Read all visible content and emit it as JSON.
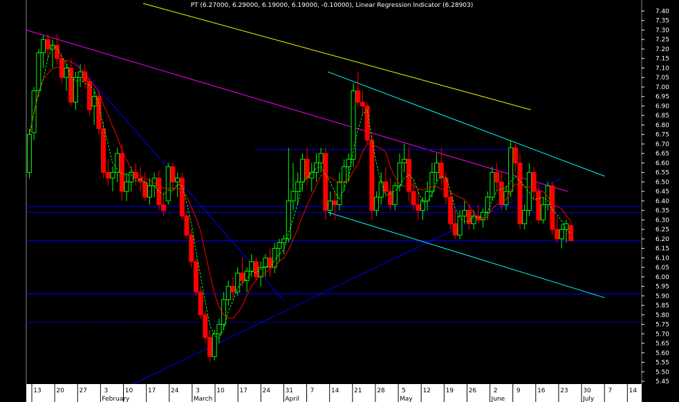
{
  "chart_data": {
    "type": "candlestick",
    "title": "PT (6.27000, 6.29000, 6.19000, 6.19000, -0.10000), Linear Regression Indicator (6.28903)",
    "ylim": [
      5.4,
      7.4
    ],
    "y_ticks": [
      "7.40",
      "7.35",
      "7.30",
      "7.25",
      "7.20",
      "7.15",
      "7.10",
      "7.05",
      "7.00",
      "6.95",
      "6.90",
      "6.85",
      "6.80",
      "6.75",
      "6.70",
      "6.65",
      "6.60",
      "6.55",
      "6.50",
      "6.45",
      "6.40",
      "6.35",
      "6.30",
      "6.25",
      "6.20",
      "6.15",
      "6.10",
      "6.05",
      "6.00",
      "5.95",
      "5.90",
      "5.85",
      "5.80",
      "5.75",
      "5.70",
      "5.65",
      "5.60",
      "5.55",
      "5.50",
      "5.45"
    ],
    "x_ticks": [
      "13",
      "20",
      "27",
      "3",
      "10",
      "17",
      "24",
      "3",
      "10",
      "17",
      "24",
      "31",
      "7",
      "14",
      "21",
      "28",
      "5",
      "12",
      "19",
      "26",
      "2",
      "9",
      "16",
      "23",
      "30",
      "7",
      "14"
    ],
    "months": [
      "February",
      "March",
      "April",
      "May",
      "June",
      "July"
    ],
    "colors": {
      "up": "#00ff00",
      "down": "#ff0000",
      "background": "#000000",
      "axis_bg": "#ffffff"
    },
    "horizontal_levels": [
      6.37,
      6.34,
      6.19,
      5.91,
      5.76
    ],
    "candles": [
      [
        6.55,
        6.78,
        6.52,
        6.75
      ],
      [
        6.76,
        7.0,
        6.72,
        6.98
      ],
      [
        6.98,
        7.2,
        6.95,
        7.18
      ],
      [
        7.18,
        7.27,
        7.1,
        7.25
      ],
      [
        7.25,
        7.28,
        7.15,
        7.2
      ],
      [
        7.2,
        7.25,
        7.1,
        7.22
      ],
      [
        7.22,
        7.28,
        7.12,
        7.15
      ],
      [
        7.15,
        7.18,
        7.02,
        7.05
      ],
      [
        7.05,
        7.12,
        6.98,
        7.1
      ],
      [
        7.1,
        7.15,
        6.9,
        6.92
      ],
      [
        6.92,
        7.08,
        6.88,
        7.05
      ],
      [
        7.05,
        7.12,
        7.0,
        7.08
      ],
      [
        7.08,
        7.12,
        7.0,
        7.03
      ],
      [
        7.03,
        7.05,
        6.85,
        6.88
      ],
      [
        6.9,
        6.98,
        6.8,
        6.95
      ],
      [
        6.95,
        6.98,
        6.75,
        6.78
      ],
      [
        6.78,
        6.82,
        6.52,
        6.55
      ],
      [
        6.55,
        6.62,
        6.48,
        6.52
      ],
      [
        6.52,
        6.58,
        6.45,
        6.55
      ],
      [
        6.55,
        6.68,
        6.5,
        6.65
      ],
      [
        6.65,
        6.7,
        6.4,
        6.45
      ],
      [
        6.45,
        6.55,
        6.4,
        6.5
      ],
      [
        6.5,
        6.58,
        6.45,
        6.55
      ],
      [
        6.55,
        6.6,
        6.48,
        6.52
      ],
      [
        6.52,
        6.58,
        6.45,
        6.5
      ],
      [
        6.5,
        6.55,
        6.4,
        6.42
      ],
      [
        6.42,
        6.52,
        6.38,
        6.48
      ],
      [
        6.48,
        6.55,
        6.42,
        6.52
      ],
      [
        6.52,
        6.56,
        6.35,
        6.38
      ],
      [
        6.38,
        6.45,
        6.32,
        6.35
      ],
      [
        6.4,
        6.6,
        6.38,
        6.58
      ],
      [
        6.58,
        6.6,
        6.45,
        6.5
      ],
      [
        6.5,
        6.55,
        6.42,
        6.52
      ],
      [
        6.52,
        6.55,
        6.3,
        6.32
      ],
      [
        6.32,
        6.35,
        6.2,
        6.22
      ],
      [
        6.22,
        6.25,
        6.05,
        6.08
      ],
      [
        6.08,
        6.1,
        5.9,
        5.92
      ],
      [
        5.92,
        5.95,
        5.78,
        5.8
      ],
      [
        5.8,
        5.82,
        5.65,
        5.68
      ],
      [
        5.68,
        5.72,
        5.55,
        5.58
      ],
      [
        5.58,
        5.72,
        5.56,
        5.7
      ],
      [
        5.7,
        5.78,
        5.65,
        5.75
      ],
      [
        5.75,
        5.92,
        5.72,
        5.88
      ],
      [
        5.88,
        5.98,
        5.85,
        5.95
      ],
      [
        5.95,
        6.0,
        5.88,
        5.92
      ],
      [
        5.92,
        6.05,
        5.9,
        6.02
      ],
      [
        6.02,
        6.1,
        5.95,
        5.98
      ],
      [
        5.98,
        6.05,
        5.92,
        6.03
      ],
      [
        6.03,
        6.12,
        6.0,
        6.08
      ],
      [
        6.08,
        6.1,
        5.98,
        6.0
      ],
      [
        6.0,
        6.08,
        5.95,
        6.05
      ],
      [
        6.05,
        6.12,
        6.0,
        6.1
      ],
      [
        6.1,
        6.15,
        6.0,
        6.05
      ],
      [
        6.05,
        6.18,
        6.02,
        6.15
      ],
      [
        6.15,
        6.2,
        6.08,
        6.18
      ],
      [
        6.18,
        6.22,
        6.12,
        6.2
      ],
      [
        6.2,
        6.68,
        6.18,
        6.4
      ],
      [
        6.4,
        6.6,
        6.35,
        6.45
      ],
      [
        6.45,
        6.55,
        6.38,
        6.5
      ],
      [
        6.5,
        6.65,
        6.45,
        6.62
      ],
      [
        6.62,
        6.68,
        6.48,
        6.52
      ],
      [
        6.52,
        6.6,
        6.45,
        6.55
      ],
      [
        6.55,
        6.65,
        6.5,
        6.6
      ],
      [
        6.6,
        6.68,
        6.55,
        6.65
      ],
      [
        6.65,
        6.68,
        6.3,
        6.35
      ],
      [
        6.35,
        6.45,
        6.32,
        6.4
      ],
      [
        6.4,
        6.45,
        6.3,
        6.38
      ],
      [
        6.38,
        6.55,
        6.35,
        6.5
      ],
      [
        6.5,
        6.62,
        6.45,
        6.58
      ],
      [
        6.58,
        6.65,
        6.5,
        6.62
      ],
      [
        6.62,
        7.02,
        6.58,
        6.98
      ],
      [
        6.98,
        7.08,
        6.9,
        6.92
      ],
      [
        6.92,
        6.98,
        6.85,
        6.9
      ],
      [
        6.9,
        6.92,
        6.7,
        6.72
      ],
      [
        6.72,
        6.75,
        6.3,
        6.35
      ],
      [
        6.35,
        6.45,
        6.32,
        6.42
      ],
      [
        6.42,
        6.55,
        6.38,
        6.5
      ],
      [
        6.5,
        6.58,
        6.42,
        6.45
      ],
      [
        6.45,
        6.52,
        6.35,
        6.38
      ],
      [
        6.38,
        6.5,
        6.35,
        6.48
      ],
      [
        6.48,
        6.65,
        6.45,
        6.6
      ],
      [
        6.6,
        6.7,
        6.55,
        6.62
      ],
      [
        6.62,
        6.68,
        6.4,
        6.45
      ],
      [
        6.45,
        6.5,
        6.35,
        6.38
      ],
      [
        6.38,
        6.45,
        6.3,
        6.35
      ],
      [
        6.35,
        6.42,
        6.3,
        6.4
      ],
      [
        6.4,
        6.5,
        6.35,
        6.45
      ],
      [
        6.45,
        6.6,
        6.42,
        6.55
      ],
      [
        6.55,
        6.65,
        6.5,
        6.6
      ],
      [
        6.6,
        6.68,
        6.48,
        6.52
      ],
      [
        6.52,
        6.55,
        6.38,
        6.42
      ],
      [
        6.42,
        6.45,
        6.25,
        6.28
      ],
      [
        6.28,
        6.35,
        6.2,
        6.22
      ],
      [
        6.22,
        6.35,
        6.2,
        6.32
      ],
      [
        6.32,
        6.4,
        6.28,
        6.35
      ],
      [
        6.35,
        6.38,
        6.25,
        6.28
      ],
      [
        6.28,
        6.35,
        6.25,
        6.32
      ],
      [
        6.32,
        6.38,
        6.28,
        6.3
      ],
      [
        6.3,
        6.36,
        6.26,
        6.34
      ],
      [
        6.34,
        6.45,
        6.3,
        6.42
      ],
      [
        6.42,
        6.58,
        6.4,
        6.55
      ],
      [
        6.55,
        6.6,
        6.45,
        6.5
      ],
      [
        6.5,
        6.55,
        6.35,
        6.38
      ],
      [
        6.38,
        6.48,
        6.35,
        6.45
      ],
      [
        6.45,
        6.72,
        6.42,
        6.68
      ],
      [
        6.68,
        6.7,
        6.55,
        6.6
      ],
      [
        6.6,
        6.65,
        6.25,
        6.28
      ],
      [
        6.28,
        6.38,
        6.25,
        6.35
      ],
      [
        6.35,
        6.6,
        6.32,
        6.55
      ],
      [
        6.55,
        6.58,
        6.4,
        6.45
      ],
      [
        6.45,
        6.48,
        6.28,
        6.3
      ],
      [
        6.3,
        6.42,
        6.28,
        6.38
      ],
      [
        6.38,
        6.5,
        6.35,
        6.48
      ],
      [
        6.48,
        6.5,
        6.22,
        6.25
      ],
      [
        6.25,
        6.32,
        6.18,
        6.2
      ],
      [
        6.2,
        6.28,
        6.15,
        6.25
      ],
      [
        6.25,
        6.3,
        6.18,
        6.28
      ],
      [
        6.27,
        6.29,
        6.19,
        6.19
      ]
    ],
    "trend_lines": [
      {
        "color": "#ffff00",
        "from": [
          0.19,
          7.44
        ],
        "to": [
          0.82,
          6.88
        ]
      },
      {
        "color": "#ff00ff",
        "from": [
          0.0,
          7.3
        ],
        "to": [
          0.88,
          6.45
        ]
      },
      {
        "color": "#0000ff",
        "from": [
          0.08,
          7.13
        ],
        "to": [
          0.42,
          5.87
        ]
      },
      {
        "color": "#0000ff",
        "from": [
          0.17,
          5.43
        ],
        "to": [
          0.87,
          6.52
        ]
      },
      {
        "color": "#0000ff",
        "from": [
          0.37,
          6.67
        ],
        "to": [
          0.79,
          6.67
        ]
      },
      {
        "color": "#00ffff",
        "from": [
          0.49,
          7.08
        ],
        "to": [
          0.94,
          6.53
        ]
      },
      {
        "color": "#00ffff",
        "from": [
          0.49,
          6.34
        ],
        "to": [
          0.94,
          5.89
        ]
      }
    ]
  }
}
